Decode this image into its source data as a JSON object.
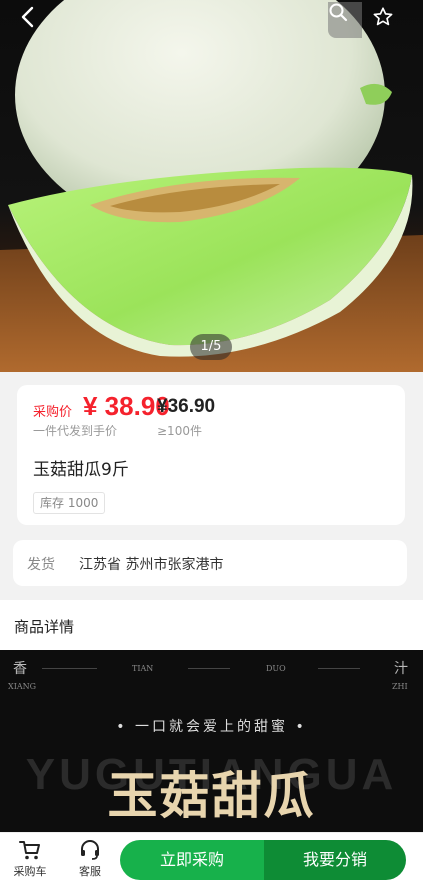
{
  "hero": {
    "pager": "1/5",
    "icons": {
      "back": "back-arrow-icon",
      "search": "search-icon",
      "favorite": "star-icon"
    }
  },
  "price": {
    "label": "采购价",
    "main": "¥ 38.90",
    "main_note": "一件代发到手价",
    "tier": "¥36.90",
    "tier_note": "≥100件",
    "color": "#f5222d"
  },
  "product": {
    "title": "玉菇甜瓜9斤",
    "stock": "库存 1000"
  },
  "shipping": {
    "label": "发货",
    "value": "江苏省  苏州市张家港市"
  },
  "details": {
    "title": "商品详情",
    "banner": {
      "top_left": "香",
      "top_left_en": "XIANG",
      "top_mid1": "TIAN",
      "top_mid2": "DUO",
      "top_right": "汁",
      "top_right_en": "ZHI",
      "slogan": "• 一口就会爱上的甜蜜 •",
      "bg_text": "YUGUTIANGUA",
      "headline": "玉菇甜瓜"
    }
  },
  "bottom_bar": {
    "cart": "采购车",
    "service": "客服",
    "buy": "立即采购",
    "share": "我要分销",
    "accent": "#17b14b"
  }
}
